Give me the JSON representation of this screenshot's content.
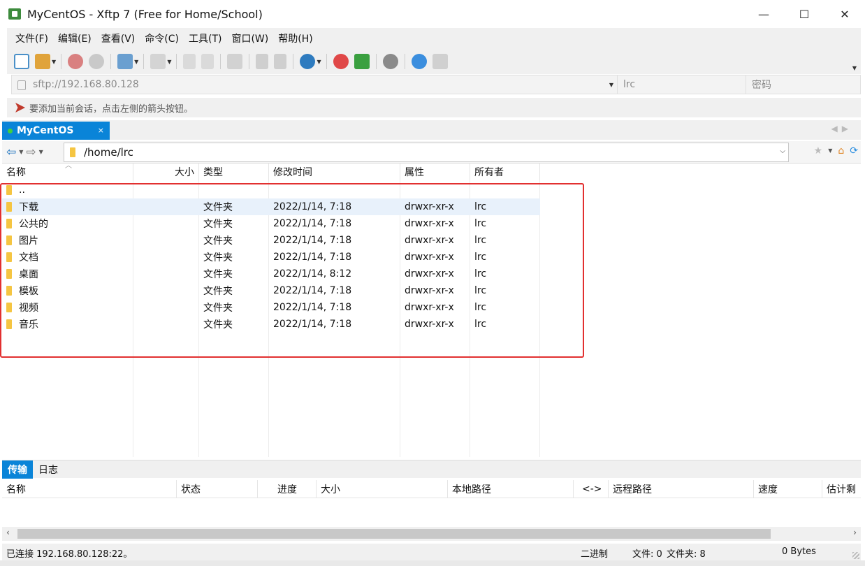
{
  "window": {
    "title": "MyCentOS - Xftp 7 (Free for Home/School)",
    "controls": {
      "minimize": "—",
      "maximize": "☐",
      "close": "✕"
    }
  },
  "menu": [
    "文件(F)",
    "编辑(E)",
    "查看(V)",
    "命令(C)",
    "工具(T)",
    "窗口(W)",
    "帮助(H)"
  ],
  "address": {
    "host": "sftp://192.168.80.128",
    "user": "lrc",
    "password_placeholder": "密码"
  },
  "hint": "要添加当前会话，点击左侧的箭头按钮。",
  "session_tab": {
    "label": "MyCentOS",
    "close": "×"
  },
  "path": "/home/lrc",
  "columns": [
    "名称",
    "大小",
    "类型",
    "修改时间",
    "属性",
    "所有者"
  ],
  "files": [
    {
      "name": "..",
      "size": "",
      "type": "",
      "modified": "",
      "attr": "",
      "owner": ""
    },
    {
      "name": "下载",
      "size": "",
      "type": "文件夹",
      "modified": "2022/1/14, 7:18",
      "attr": "drwxr-xr-x",
      "owner": "lrc"
    },
    {
      "name": "公共的",
      "size": "",
      "type": "文件夹",
      "modified": "2022/1/14, 7:18",
      "attr": "drwxr-xr-x",
      "owner": "lrc"
    },
    {
      "name": "图片",
      "size": "",
      "type": "文件夹",
      "modified": "2022/1/14, 7:18",
      "attr": "drwxr-xr-x",
      "owner": "lrc"
    },
    {
      "name": "文档",
      "size": "",
      "type": "文件夹",
      "modified": "2022/1/14, 7:18",
      "attr": "drwxr-xr-x",
      "owner": "lrc"
    },
    {
      "name": "桌面",
      "size": "",
      "type": "文件夹",
      "modified": "2022/1/14, 8:12",
      "attr": "drwxr-xr-x",
      "owner": "lrc"
    },
    {
      "name": "模板",
      "size": "",
      "type": "文件夹",
      "modified": "2022/1/14, 7:18",
      "attr": "drwxr-xr-x",
      "owner": "lrc"
    },
    {
      "name": "视频",
      "size": "",
      "type": "文件夹",
      "modified": "2022/1/14, 7:18",
      "attr": "drwxr-xr-x",
      "owner": "lrc"
    },
    {
      "name": "音乐",
      "size": "",
      "type": "文件夹",
      "modified": "2022/1/14, 7:18",
      "attr": "drwxr-xr-x",
      "owner": "lrc"
    }
  ],
  "transfer_tabs": [
    "传输",
    "日志"
  ],
  "transfer_columns": [
    "名称",
    "状态",
    "进度",
    "大小",
    "本地路径",
    "<->",
    "远程路径",
    "速度",
    "估计剩"
  ],
  "status": {
    "connection": "已连接 192.168.80.128:22。",
    "mode": "二进制",
    "files": "文件: 0",
    "folders": "文件夹: 8",
    "size": "0 Bytes"
  },
  "colors": {
    "accent": "#0a84d8",
    "highlight_box": "#e23030",
    "folder": "#f5c542"
  }
}
